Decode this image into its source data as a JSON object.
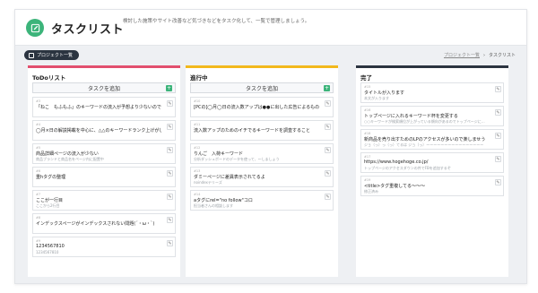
{
  "header": {
    "title": "タスクリスト",
    "description": "検討した施策やサイト改善など気づきなどをタスク化して、一覧で管理しましょう。"
  },
  "toolbar": {
    "project_button": "プロジェクト一覧"
  },
  "breadcrumb": {
    "parent": "プロジェクト一覧",
    "separator": "›",
    "current": "タスクリスト"
  },
  "columns": {
    "todo": {
      "title": "ToDoリスト",
      "add_label": "タスクを追加",
      "cards": [
        {
          "num": "#3",
          "title": "「ねこ　もふもふ」のキーワードの流入が予想より少ないので、対策…",
          "desc": ""
        },
        {
          "num": "#4",
          "title": "◯月×日の解説掲載を中心に、△△のキーワードランク上げがしたい…",
          "desc": ""
        },
        {
          "num": "#5",
          "title": "商品詳細ページの流入が少ない",
          "desc": "商品ブランドと商品名をページ内に配置中"
        },
        {
          "num": "#6",
          "title": "重hタグの整理",
          "desc": ""
        },
        {
          "num": "#7",
          "title": "ここが一行目",
          "desc": "ここから2行目"
        },
        {
          "num": "#8",
          "title": "インデックスページがインデックスされない問題(´・ω・`)",
          "desc": ""
        },
        {
          "num": "#9",
          "title": "1234567810",
          "desc": "1234567810"
        }
      ]
    },
    "doing": {
      "title": "進行中",
      "add_label": "タスクを追加",
      "cards": [
        {
          "num": "#10",
          "title": "[PCの]◯月◯日の流入数アップは●●に出した広告によるものです",
          "desc": ""
        },
        {
          "num": "#11",
          "title": "流入数アップのためのイチでるキーワードを調査すること",
          "desc": ""
        },
        {
          "num": "#12",
          "title": "りんご　入荷キーワード",
          "desc": "分析ダッシュボードのデータを使って、〜しましょう"
        },
        {
          "num": "#13",
          "title": "ダミーページに差異表示されてるよ",
          "desc": "noindexテリーズ"
        },
        {
          "num": "#14",
          "title": "aタグにrel=\"no follow\"コロ",
          "desc": "担当者さんの相談します"
        }
      ]
    },
    "done": {
      "title": "完了",
      "cards": [
        {
          "num": "#15",
          "title": "タイトルが入ります",
          "desc": "本文が入ります"
        },
        {
          "num": "#16",
          "title": "トップページに入れるキーワード杯を変更する",
          "desc": "○○キーワードが検索順位が上がっている傾向があるのでトップページに…"
        },
        {
          "num": "#18",
          "title": "新商品を売り出すためのLPのアクセスが多いので楽しませう",
          "desc": "ジョ（っ）っ（っ）てるは ジョ（っ）ーーーーーーーーーーーーーーーー"
        },
        {
          "num": "#17",
          "title": "https://www.hogehoge.co.jp/",
          "desc": "トップページのアクセスダウンの件でFBを追加するぞ"
        },
        {
          "num": "#19",
          "title": "<title>タグ重複してる〜〜〜",
          "desc": "修正済み"
        }
      ]
    }
  },
  "colors": {
    "accent_green": "#3cb47a",
    "todo": "#e24f6e",
    "doing": "#f2b81c",
    "done": "#2b3440"
  },
  "icons": {
    "logo": "edit-square-icon",
    "edit": "pencil-icon",
    "add": "plus-icon",
    "project": "folder-icon"
  }
}
